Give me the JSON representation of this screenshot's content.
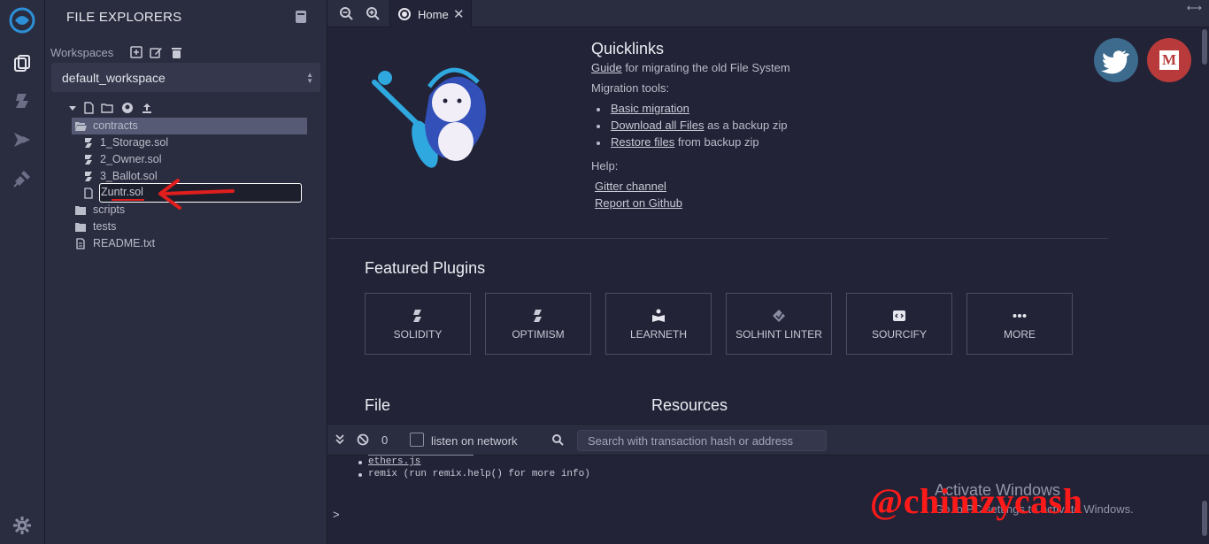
{
  "icon_rail": {
    "items": [
      {
        "icon": "remix-logo-icon"
      },
      {
        "icon": "file-explorer-icon"
      },
      {
        "icon": "solidity-compiler-icon"
      },
      {
        "icon": "deploy-run-icon"
      },
      {
        "icon": "plugin-manager-icon"
      },
      {
        "icon": "settings-gear-icon"
      }
    ]
  },
  "file_explorer": {
    "title": "FILE EXPLORERS",
    "workspaces_label": "Workspaces",
    "workspace_selected": "default_workspace",
    "tree": {
      "folders": {
        "contracts": "contracts",
        "scripts": "scripts",
        "tests": "tests"
      },
      "files": {
        "storage": "1_Storage.sol",
        "owner": "2_Owner.sol",
        "ballot": "3_Ballot.sol",
        "readme": "README.txt"
      },
      "rename_input_value": "Zuntr.sol"
    }
  },
  "tabs": {
    "home": "Home"
  },
  "quicklinks": {
    "title": "Quicklinks",
    "guide_link": "Guide",
    "guide_text": " for migrating the old File System",
    "migration_tools": "Migration tools:",
    "basic_migration": "Basic migration",
    "download_link": "Download all Files",
    "download_text": " as a backup zip",
    "restore_link": "Restore files",
    "restore_text": " from backup zip",
    "help": "Help:",
    "gitter": "Gitter channel",
    "github": "Report on Github"
  },
  "social": {
    "medium_letter": "M"
  },
  "featured_plugins": {
    "title": "Featured Plugins",
    "items": [
      {
        "label": "SOLIDITY",
        "icon": "solidity-icon"
      },
      {
        "label": "OPTIMISM",
        "icon": "optimism-icon"
      },
      {
        "label": "LEARNETH",
        "icon": "learneth-icon"
      },
      {
        "label": "SOLHINT LINTER",
        "icon": "solhint-icon"
      },
      {
        "label": "SOURCIFY",
        "icon": "sourcify-icon"
      },
      {
        "label": "MORE",
        "icon": "more-dots-icon"
      }
    ]
  },
  "sections": {
    "file": "File",
    "resources": "Resources"
  },
  "terminal": {
    "pending_count": "0",
    "listen_label": "listen on network",
    "search_placeholder": "Search with transaction hash or address",
    "lines": {
      "ethers": "ethers.js",
      "remix": "remix (run remix.help() for more info)"
    },
    "prompt": ">"
  },
  "overlay": {
    "activate_title": "Activate Windows",
    "activate_sub": "Go to PC settings to activate Windows.",
    "watermark": "@chimzycash"
  },
  "colors": {
    "background": "#222336",
    "panel": "#2a2c3f",
    "selection": "#565a75",
    "twitter": "#3d6b8e",
    "medium": "#b83a3a",
    "annotation": "#e01e1e",
    "accent_blue": "#2d8fd6"
  }
}
